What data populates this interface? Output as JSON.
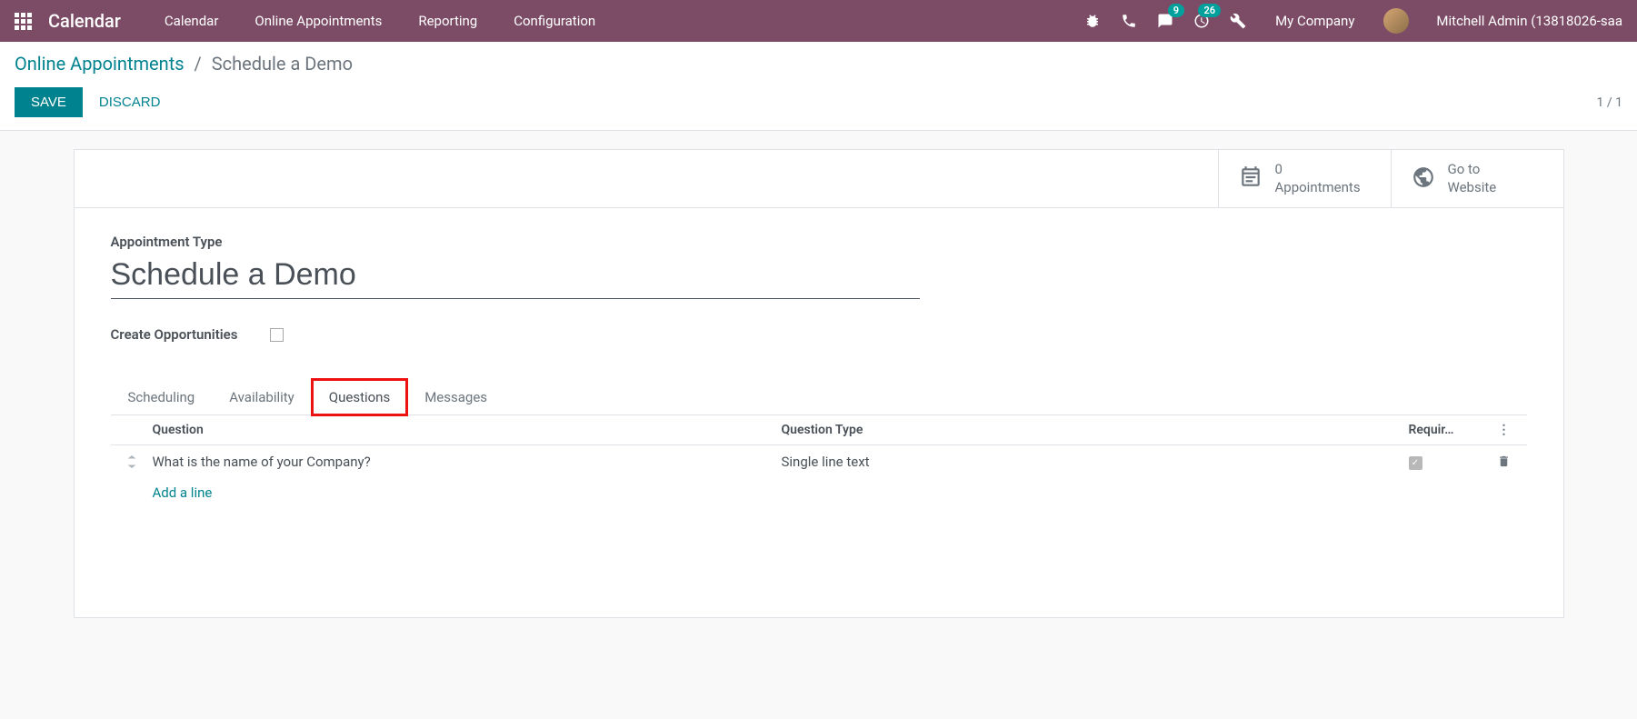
{
  "navbar": {
    "app_title": "Calendar",
    "links": [
      "Calendar",
      "Online Appointments",
      "Reporting",
      "Configuration"
    ],
    "badge_messages": "9",
    "badge_activities": "26",
    "company": "My Company",
    "user": "Mitchell Admin (13818026-saa"
  },
  "breadcrumb": {
    "parent": "Online Appointments",
    "current": "Schedule a Demo"
  },
  "buttons": {
    "save": "SAVE",
    "discard": "DISCARD",
    "pager": "1 / 1"
  },
  "stat_buttons": {
    "appointments_count": "0",
    "appointments_label": "Appointments",
    "website_line1": "Go to",
    "website_line2": "Website"
  },
  "form": {
    "appointment_type_label": "Appointment Type",
    "appointment_type_value": "Schedule a Demo",
    "create_opps_label": "Create Opportunities"
  },
  "tabs": {
    "scheduling": "Scheduling",
    "availability": "Availability",
    "questions": "Questions",
    "messages": "Messages"
  },
  "questions_table": {
    "header_question": "Question",
    "header_type": "Question Type",
    "header_required": "Requir…",
    "rows": [
      {
        "question": "What is the name of your Company?",
        "type": "Single line text",
        "required": true
      }
    ],
    "add_line": "Add a line"
  }
}
